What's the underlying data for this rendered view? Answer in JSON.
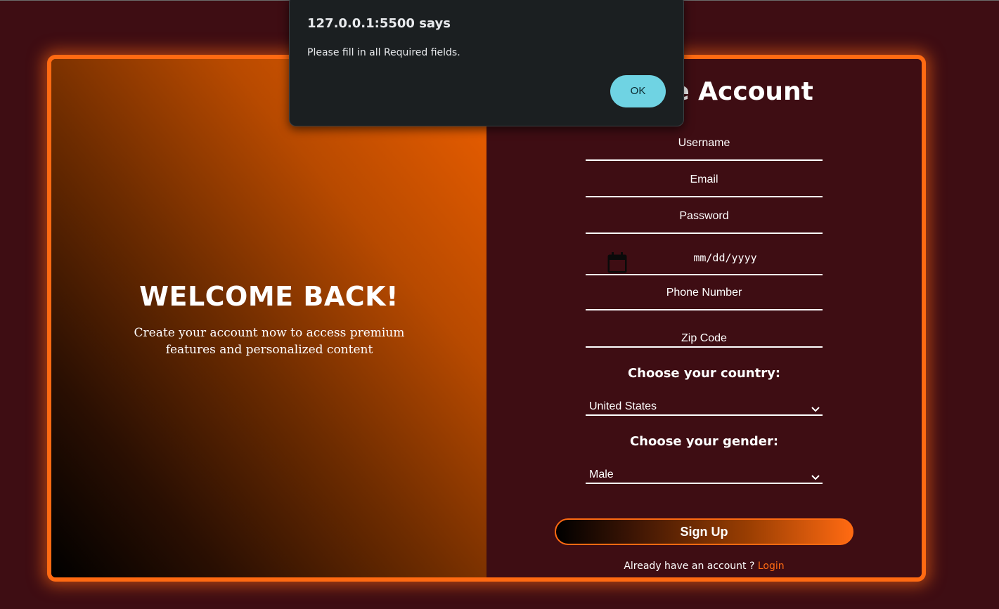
{
  "dialog": {
    "title": "127.0.0.1:5500 says",
    "message": "Please fill in all Required fields.",
    "ok_label": "OK"
  },
  "welcome": {
    "title": "WELCOME BACK!",
    "subtitle_line1": "Create your account now to access premium",
    "subtitle_line2": "features and personalized content"
  },
  "form": {
    "title": "Create Account",
    "username_placeholder": "Username",
    "email_placeholder": "Email",
    "password_placeholder": "Password",
    "date_placeholder": "mm/dd/yyyy",
    "phone_placeholder": "Phone Number",
    "zip_placeholder": "Zip Code",
    "country_label": "Choose your country:",
    "country_value": "United States",
    "gender_label": "Choose your gender:",
    "gender_value": "Male",
    "signup_label": "Sign Up",
    "already_text": "Already have an account ?",
    "login_label": "Login"
  },
  "colors": {
    "background": "#3e0d13",
    "accent": "#ff6a12",
    "dialog_button": "#6fd3e3"
  },
  "icons": {
    "calendar": "calendar-icon",
    "chevron": "chevron-down-icon"
  }
}
